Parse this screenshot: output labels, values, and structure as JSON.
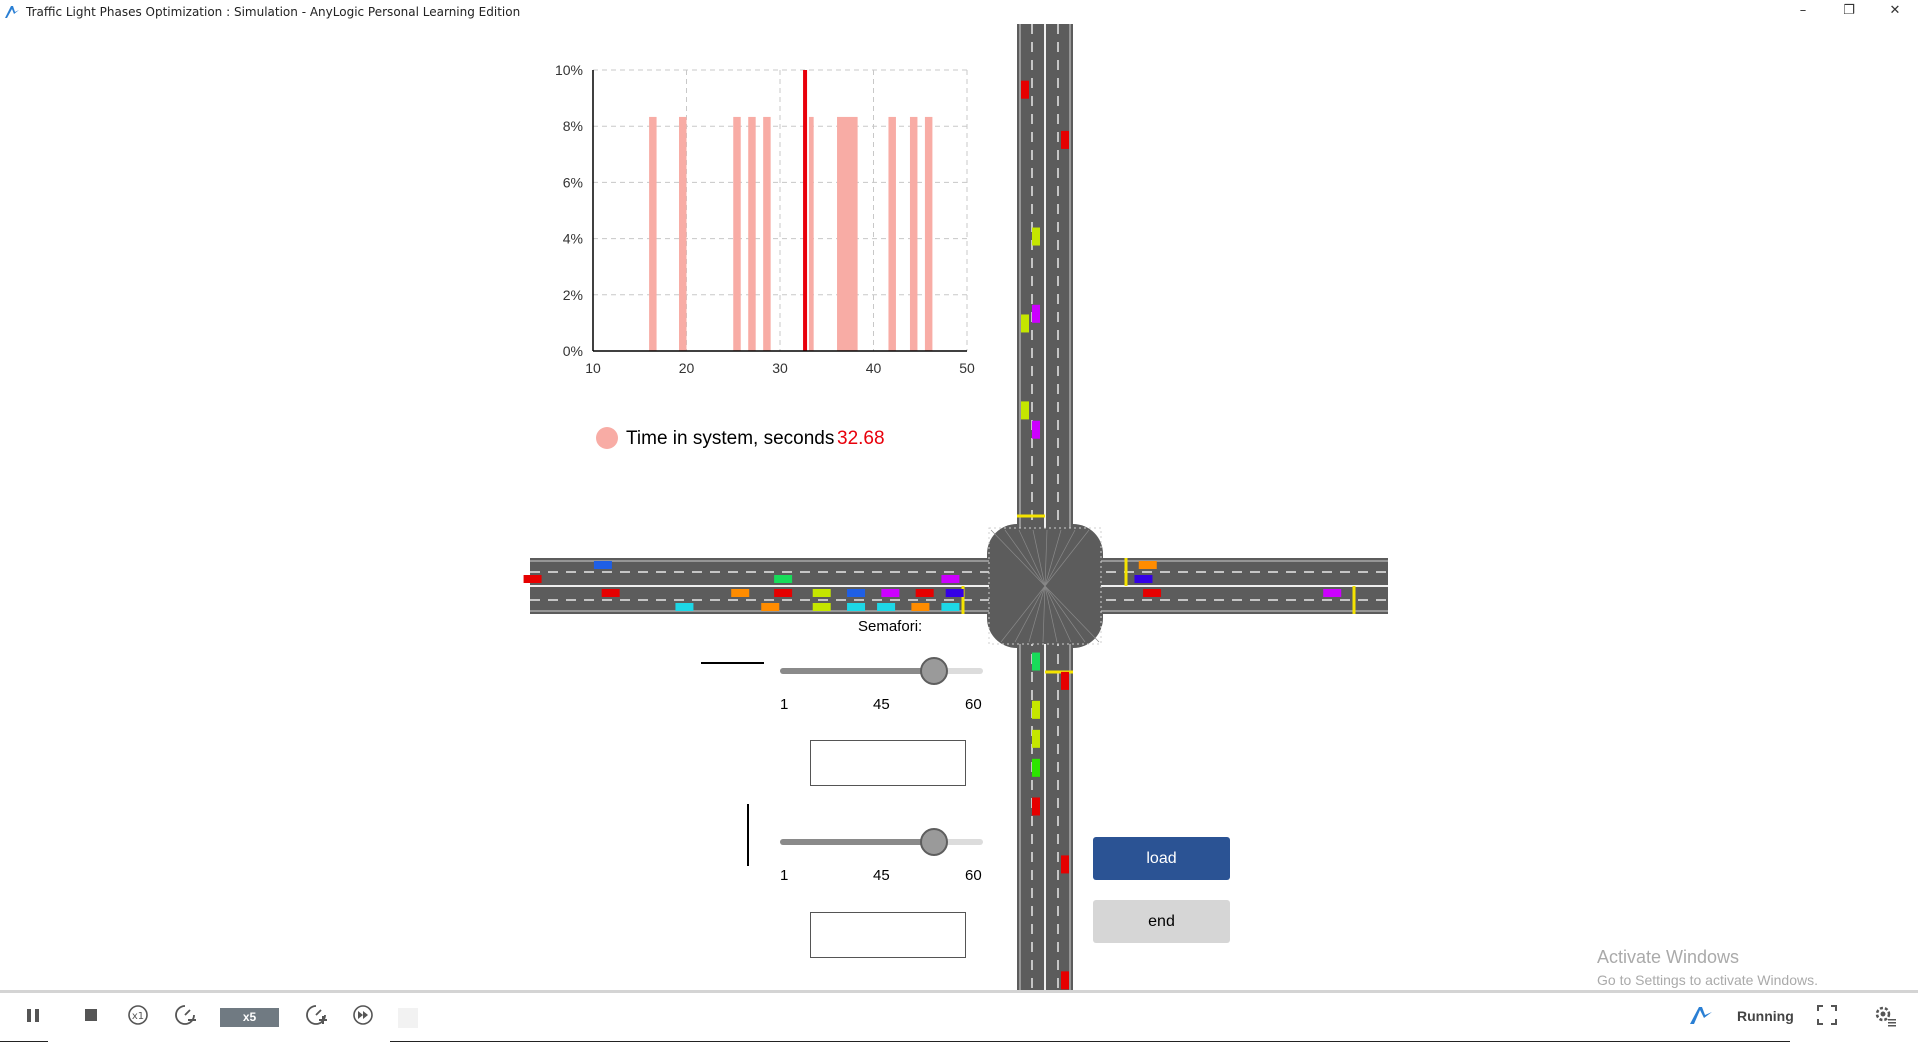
{
  "window": {
    "title": "Traffic Light Phases Optimization : Simulation - AnyLogic Personal Learning Edition",
    "controls": [
      "–",
      "❐",
      "✕"
    ]
  },
  "chart_data": {
    "type": "bar",
    "x_ticks": [
      10,
      20,
      30,
      40,
      50
    ],
    "y_ticks": [
      "0%",
      "2%",
      "4%",
      "6%",
      "8%",
      "10%"
    ],
    "xlim": [
      10,
      50
    ],
    "ylim": [
      0,
      10
    ],
    "grid": true,
    "bars": [
      {
        "x": 16.0,
        "width": 0.8,
        "y": 8.33
      },
      {
        "x": 19.2,
        "width": 0.8,
        "y": 8.33
      },
      {
        "x": 25.0,
        "width": 0.8,
        "y": 8.33
      },
      {
        "x": 26.6,
        "width": 0.8,
        "y": 8.33
      },
      {
        "x": 28.2,
        "width": 0.8,
        "y": 8.33
      },
      {
        "x": 33.1,
        "width": 0.5,
        "y": 8.33
      },
      {
        "x": 36.1,
        "width": 2.2,
        "y": 8.33
      },
      {
        "x": 41.6,
        "width": 0.8,
        "y": 8.33
      },
      {
        "x": 43.9,
        "width": 0.8,
        "y": 8.33
      },
      {
        "x": 45.5,
        "width": 0.8,
        "y": 8.33
      }
    ],
    "mean_marker": {
      "x": 32.68,
      "color": "#e8000b"
    },
    "series": [
      {
        "name": "Time in system, seconds",
        "value": "32.68",
        "color": "#f8aca5"
      }
    ]
  },
  "controls": {
    "semafori_label": "Semafori:",
    "slider1": {
      "min_label": "1",
      "mid_label": "45",
      "max_label": "60",
      "fraction": 0.76
    },
    "slider2": {
      "min_label": "1",
      "mid_label": "45",
      "max_label": "60",
      "fraction": 0.76
    },
    "input1_value": "",
    "input2_value": "",
    "load_label": "load",
    "end_label": "end"
  },
  "watermark": {
    "title": "Activate Windows",
    "subtitle": "Go to Settings to activate Windows."
  },
  "toolbar": {
    "speed_label": "x5",
    "status": "Running",
    "icons": [
      "pause-icon",
      "stop-icon",
      "realtime-x1-icon",
      "slow-down-icon",
      "speed-up-icon",
      "fast-forward-icon",
      "app-logo-icon",
      "fullscreen-icon",
      "settings-icon"
    ]
  },
  "colors": {
    "road": "#5c5c5c",
    "stop_line": "#f5e300",
    "bar": "#f8aca5",
    "mean": "#e8000b",
    "load_button": "#2b5394"
  },
  "vehicles": {
    "vertical_road": [
      {
        "lane": "left",
        "at": 0.068,
        "color": "#e60000"
      },
      {
        "lane": "right",
        "at": 0.12,
        "color": "#e60000"
      },
      {
        "lane": "mid",
        "at": 0.22,
        "color": "#c5e600"
      },
      {
        "lane": "mid",
        "at": 0.3,
        "color": "#cc00ff"
      },
      {
        "lane": "left",
        "at": 0.31,
        "color": "#c5e600"
      },
      {
        "lane": "left",
        "at": 0.4,
        "color": "#c5e600"
      },
      {
        "lane": "mid",
        "at": 0.42,
        "color": "#cc00ff"
      },
      {
        "lane": "mid",
        "at": 0.66,
        "color": "#18dc5a"
      },
      {
        "lane": "right",
        "at": 0.68,
        "color": "#e60000"
      },
      {
        "lane": "mid",
        "at": 0.71,
        "color": "#c5e600"
      },
      {
        "lane": "mid",
        "at": 0.74,
        "color": "#c5e600"
      },
      {
        "lane": "mid",
        "at": 0.77,
        "color": "#2ce600"
      },
      {
        "lane": "mid",
        "at": 0.81,
        "color": "#e60000"
      },
      {
        "lane": "right",
        "at": 0.87,
        "color": "#e60000"
      },
      {
        "lane": "right",
        "at": 0.99,
        "color": "#e60000"
      }
    ],
    "horizontal_road": [
      {
        "lane": 0,
        "at": 0.085,
        "color": "#1f5fe6"
      },
      {
        "lane": 2,
        "at": 0.094,
        "color": "#e60000"
      },
      {
        "lane": 1,
        "at": 0.003,
        "color": "#e60000"
      },
      {
        "lane": 3,
        "at": 0.18,
        "color": "#1ed7e6"
      },
      {
        "lane": 1,
        "at": 0.295,
        "color": "#18dc5a"
      },
      {
        "lane": 2,
        "at": 0.245,
        "color": "#ff8c00"
      },
      {
        "lane": 2,
        "at": 0.295,
        "color": "#e60000"
      },
      {
        "lane": 3,
        "at": 0.28,
        "color": "#ff8c00"
      },
      {
        "lane": 2,
        "at": 0.34,
        "color": "#c5e600"
      },
      {
        "lane": 3,
        "at": 0.34,
        "color": "#c5e600"
      },
      {
        "lane": 2,
        "at": 0.38,
        "color": "#1f5fe6"
      },
      {
        "lane": 3,
        "at": 0.38,
        "color": "#1ed7e6"
      },
      {
        "lane": 2,
        "at": 0.42,
        "color": "#cc00ff"
      },
      {
        "lane": 3,
        "at": 0.415,
        "color": "#1ed7e6"
      },
      {
        "lane": 2,
        "at": 0.46,
        "color": "#e60000"
      },
      {
        "lane": 3,
        "at": 0.455,
        "color": "#ff8c00"
      },
      {
        "lane": 2,
        "at": 0.495,
        "color": "#3400e6"
      },
      {
        "lane": 3,
        "at": 0.49,
        "color": "#1ed7e6"
      },
      {
        "lane": 1,
        "at": 0.49,
        "color": "#cc00ff"
      },
      {
        "lane": 0,
        "at": 0.72,
        "color": "#ff8c00"
      },
      {
        "lane": 1,
        "at": 0.715,
        "color": "#3400e6"
      },
      {
        "lane": 2,
        "at": 0.725,
        "color": "#e60000"
      },
      {
        "lane": 2,
        "at": 0.935,
        "color": "#cc00ff"
      }
    ]
  }
}
